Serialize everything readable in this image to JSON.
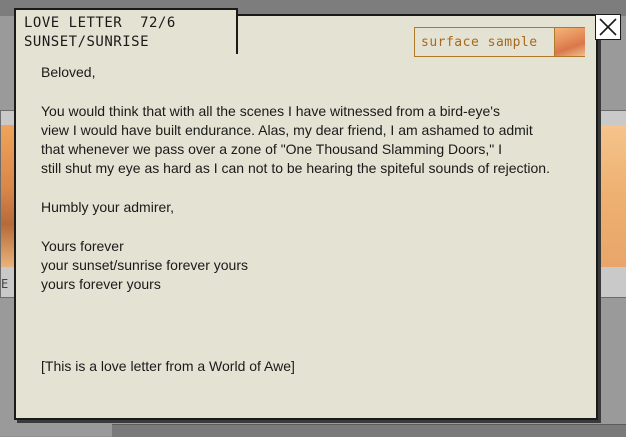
{
  "background": {
    "left_panel_text": "E"
  },
  "window": {
    "tab_title_line1": "LOVE LETTER  72/6",
    "tab_title_line2": "SUNSET/SUNRISE",
    "close_icon": "close-icon"
  },
  "surface_sample": {
    "label": "surface sample",
    "swatch_colors": [
      "#f2b47a",
      "#e6905a",
      "#d9774a",
      "#f0c090"
    ]
  },
  "letter": {
    "salutation": "Beloved,",
    "body_lines": [
      "You would think that with all the scenes I have witnessed from a bird-eye's",
      "view I would have built endurance. Alas, my dear friend, I am ashamed to admit",
      "that whenever we pass over a zone of \"One Thousand Slamming Doors,\" I",
      "still shut my eye as hard as I can not to be hearing the spiteful sounds of rejection."
    ],
    "humbly": "Humbly your admirer,",
    "closing_lines": [
      "Yours forever",
      "your sunset/sunrise forever yours",
      "yours forever yours"
    ],
    "footnote": "[This is a love letter from a World of Awe]"
  },
  "colors": {
    "paper": "#e3e2d3",
    "ink": "#1a1a1a",
    "accent_gold": "#a8691c"
  }
}
